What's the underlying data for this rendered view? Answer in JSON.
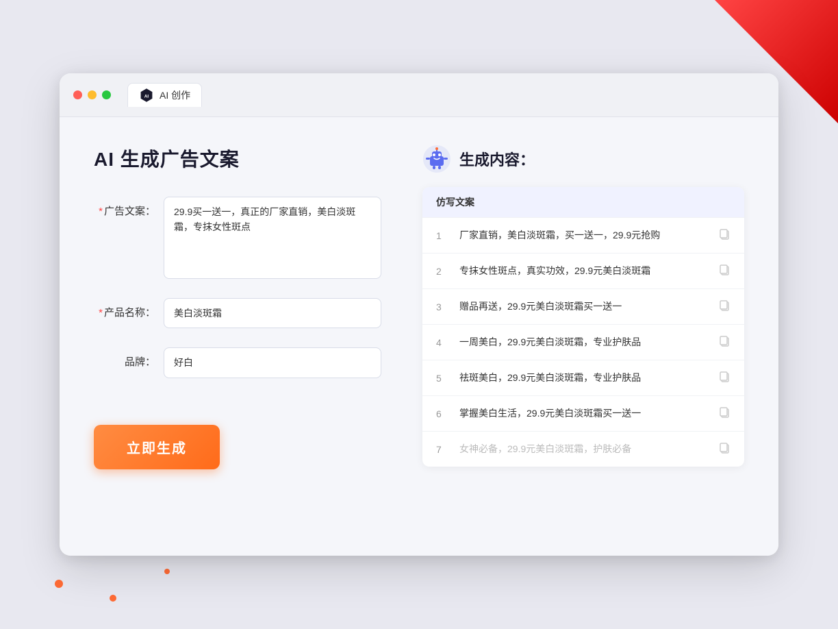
{
  "window": {
    "title_tab": "AI 创作"
  },
  "page": {
    "title": "AI 生成广告文案"
  },
  "form": {
    "ad_copy_label": "广告文案：",
    "ad_copy_required": "*",
    "ad_copy_value": "29.9买一送一，真正的厂家直销，美白淡斑霜，专抹女性斑点",
    "product_label": "产品名称：",
    "product_required": "*",
    "product_value": "美白淡斑霜",
    "brand_label": "品牌：",
    "brand_value": "好白",
    "generate_button": "立即生成"
  },
  "result": {
    "header_label": "生成内容：",
    "column_label": "仿写文案",
    "items": [
      {
        "num": "1",
        "text": "厂家直销，美白淡斑霜，买一送一，29.9元抢购",
        "muted": false
      },
      {
        "num": "2",
        "text": "专抹女性斑点，真实功效，29.9元美白淡斑霜",
        "muted": false
      },
      {
        "num": "3",
        "text": "赠品再送，29.9元美白淡斑霜买一送一",
        "muted": false
      },
      {
        "num": "4",
        "text": "一周美白，29.9元美白淡斑霜，专业护肤品",
        "muted": false
      },
      {
        "num": "5",
        "text": "祛斑美白，29.9元美白淡斑霜，专业护肤品",
        "muted": false
      },
      {
        "num": "6",
        "text": "掌握美白生活，29.9元美白淡斑霜买一送一",
        "muted": false
      },
      {
        "num": "7",
        "text": "女神必备，29.9元美白淡斑霜，护肤必备",
        "muted": true
      }
    ]
  },
  "colors": {
    "accent_orange": "#ff6b1a",
    "accent_blue": "#5b6cf0",
    "required_red": "#ff4444"
  }
}
